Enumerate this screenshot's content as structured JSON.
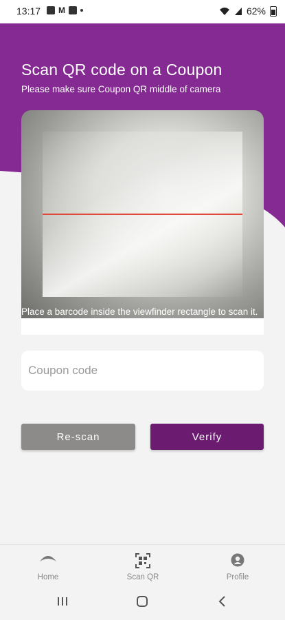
{
  "status_bar": {
    "time": "13:17",
    "left_icons": [
      "gallery-icon",
      "m-icon",
      "app-badge-icon",
      "notification-dot"
    ],
    "m_glyph": "M",
    "battery_text": "62%"
  },
  "header": {
    "title": "Scan QR code on a Coupon",
    "subtitle": "Please make sure Coupon QR middle of camera",
    "color": "#862a93"
  },
  "camera": {
    "hint": "Place a barcode inside the viewfinder rectangle to scan it.",
    "laser_color": "#e04a3a"
  },
  "coupon": {
    "placeholder": "Coupon code",
    "value": ""
  },
  "buttons": {
    "rescan_label": "Re-scan",
    "verify_label": "Verify",
    "rescan_color": "#8d8a8a",
    "verify_color": "#6b1c71"
  },
  "bottom_nav": {
    "items": [
      {
        "label": "Home",
        "icon": "home-icon"
      },
      {
        "label": "Scan QR",
        "icon": "qr-scan-icon"
      },
      {
        "label": "Profile",
        "icon": "profile-icon"
      }
    ]
  },
  "system_nav": {
    "buttons": [
      "recent-apps-icon",
      "home-button-icon",
      "back-icon"
    ]
  }
}
